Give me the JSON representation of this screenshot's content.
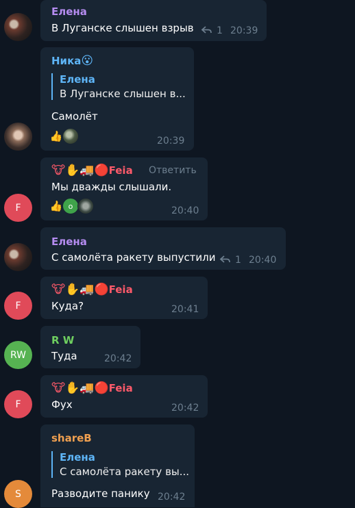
{
  "colors": {
    "background": "#0e1621",
    "bubble": "#182533",
    "name_elena": "#b58cf0",
    "name_nika": "#5eb5f7",
    "name_feia": "#ff5a6a",
    "name_rw": "#6fcf60",
    "name_shareb": "#f0a050",
    "quote_accent": "#5eb5f7",
    "time": "#6d7f8f"
  },
  "messages": [
    {
      "author": "Елена",
      "text": "В Луганске слышен взрыв",
      "replies": "1",
      "time": "20:39"
    },
    {
      "author": "Ника",
      "author_emoji": "😮",
      "quote_author": "Елена",
      "quote_text": "В Луганске слышен в...",
      "text": "Самолёт",
      "time": "20:39",
      "reactions": [
        "👍"
      ]
    },
    {
      "author_emoji": "🐮✋🚚🔴",
      "author": "Feia",
      "action": "Ответить",
      "avatar": "F",
      "text": "Мы дважды слышали.",
      "time": "20:40",
      "reactions": [
        "👍"
      ],
      "reaction_badge": "o"
    },
    {
      "author": "Елена",
      "text": "С самолёта ракету выпустили",
      "replies": "1",
      "time": "20:40"
    },
    {
      "author_emoji": "🐮✋🚚🔴",
      "author": "Feia",
      "avatar": "F",
      "text": "Куда?",
      "time": "20:41"
    },
    {
      "author": "R W",
      "avatar": "RW",
      "text": "Туда",
      "time": "20:42"
    },
    {
      "author_emoji": "🐮✋🚚🔴",
      "author": "Feia",
      "avatar": "F",
      "text": "Фух",
      "time": "20:42"
    },
    {
      "author": "shareB",
      "avatar": "S",
      "quote_author": "Елена",
      "quote_text": "С самолёта ракету вы...",
      "text": "Разводите панику",
      "time": "20:42"
    }
  ]
}
